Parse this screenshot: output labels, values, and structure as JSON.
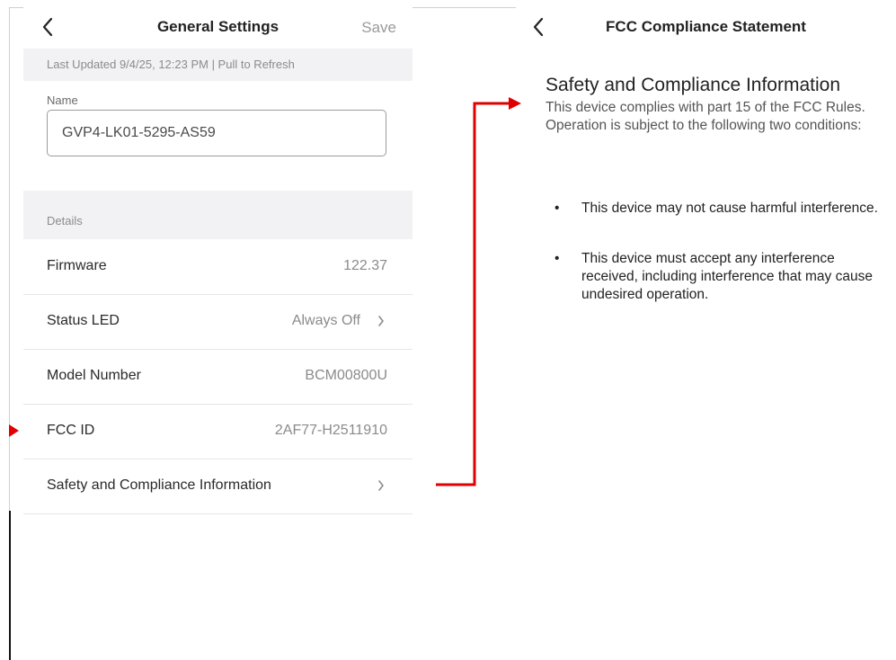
{
  "general_settings": {
    "title": "General Settings",
    "save_label": "Save",
    "last_updated": "Last Updated 9/4/25, 12:23 PM | Pull to Refresh",
    "name_label": "Name",
    "name_value": "GVP4-LK01-5295-AS59",
    "details_header": "Details",
    "rows": [
      {
        "label": "Firmware",
        "value": "122.37"
      },
      {
        "label": "Status LED",
        "value": "Always Off"
      },
      {
        "label": "Model Number",
        "value": "BCM00800U"
      },
      {
        "label": "FCC ID",
        "value": "2AF77-H2511910"
      },
      {
        "label": "Safety and Compliance Information",
        "value": ""
      }
    ]
  },
  "fcc_statement": {
    "title": "FCC Compliance Statement",
    "heading": "Safety and Compliance Information",
    "intro": "This device complies with part 15 of the FCC Rules. Operation is subject to the following two conditions:",
    "bullets": [
      "This device may not cause harmful interference.",
      "This device must accept any interference received, including interference that may cause undesired operation."
    ]
  },
  "icons": [
    "back-icon",
    "chevron-right-icon",
    "red-arrow-annotation"
  ],
  "colors": {
    "annotation_red": "#e00000",
    "section_bg": "#f2f2f4",
    "muted_text": "#8b8b8b"
  }
}
